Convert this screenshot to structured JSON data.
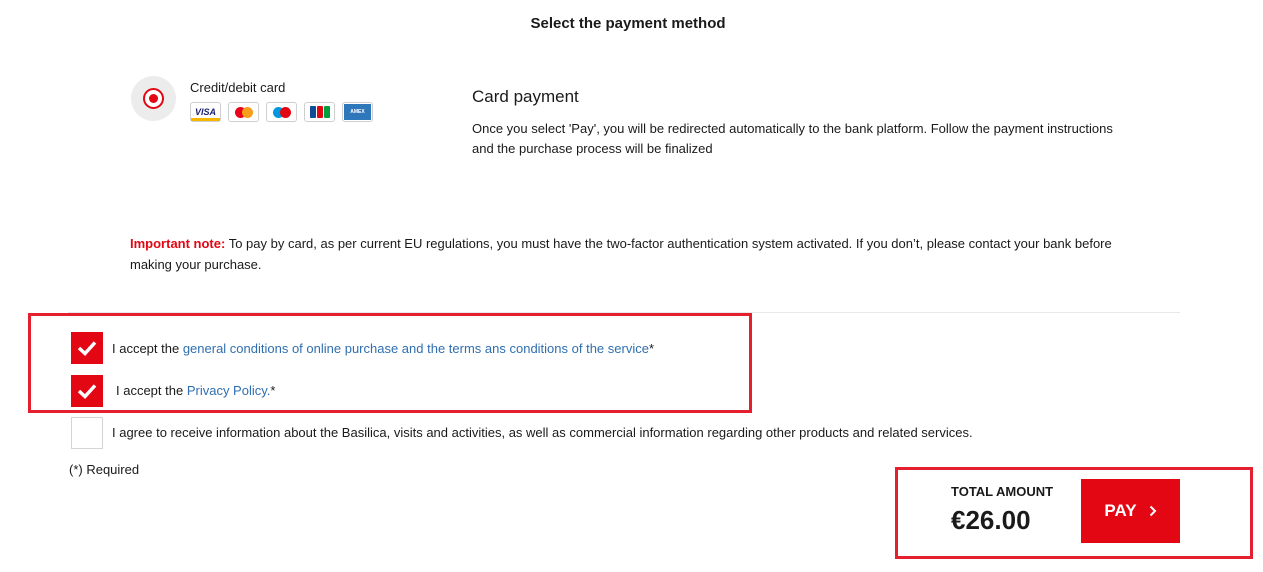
{
  "page": {
    "title": "Select the payment method"
  },
  "payment_method": {
    "label": "Credit/debit card",
    "selected": true,
    "card_logos": [
      {
        "icon": "visa-logo",
        "text": "VISA"
      },
      {
        "icon": "mastercard-logo"
      },
      {
        "icon": "maestro-logo",
        "text": "Maestro"
      },
      {
        "icon": "jcb-logo",
        "text": "JCB"
      },
      {
        "icon": "american-express-logo",
        "text": "AMERICAN EXPRESS"
      }
    ]
  },
  "description": {
    "title": "Card payment",
    "text": "Once you select 'Pay', you will be redirected automatically to the bank platform. Follow the payment instructions and the purchase process will be finalized"
  },
  "note": {
    "label": "Important note:",
    "text": " To pay by card, as per current EU regulations, you must have the two-factor authentication system activated. If you don’t, please contact your bank before making your purchase."
  },
  "consents": {
    "terms": {
      "checked": true,
      "prefix": "I accept the ",
      "link": "general conditions of online purchase and the terms ans conditions of the service",
      "suffix": "*"
    },
    "privacy": {
      "checked": true,
      "prefix": "I accept the ",
      "link": "Privacy Policy.",
      "suffix": "*"
    },
    "marketing": {
      "checked": false,
      "text": "I agree to receive information about the Basilica, visits and activities, as well as commercial information regarding other products and related services."
    }
  },
  "required_note": "(*) Required",
  "total": {
    "label": "TOTAL AMOUNT",
    "value": "€26.00"
  },
  "pay_button": {
    "label": "PAY",
    "icon": "chevron-right-icon"
  },
  "colors": {
    "accent": "#e30613",
    "link": "#2f6fb0",
    "highlight": "#e5202e"
  }
}
